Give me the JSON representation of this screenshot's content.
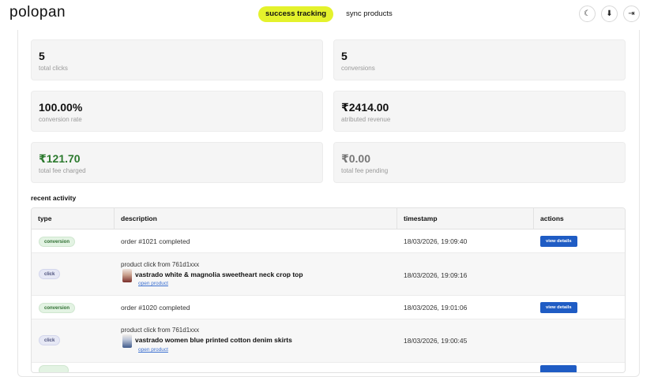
{
  "app": {
    "logo": "polopan"
  },
  "nav": {
    "tabs": [
      {
        "label": "success tracking",
        "active": true
      },
      {
        "label": "sync products",
        "active": false
      }
    ]
  },
  "top_icons": [
    {
      "name": "moon-icon",
      "glyph": "☾"
    },
    {
      "name": "download-icon",
      "glyph": "⬇"
    },
    {
      "name": "logout-icon",
      "glyph": "⇥"
    }
  ],
  "stats": [
    {
      "value": "5",
      "label": "total clicks"
    },
    {
      "value": "5",
      "label": "conversions"
    },
    {
      "value": "100.00%",
      "label": "conversion rate"
    },
    {
      "value": "₹2414.00",
      "label": "atributed revenue"
    },
    {
      "value": "₹121.70",
      "label": "total fee charged"
    },
    {
      "value": "₹0.00",
      "label": "total fee pending"
    }
  ],
  "colors": {
    "accent": "#e4f22c",
    "primary_button": "#1f5cc4",
    "fee_charged": "#2c7a2e"
  },
  "activity": {
    "title": "recent activity",
    "columns": [
      "type",
      "description",
      "timestamp",
      "actions"
    ],
    "rows": [
      {
        "type": "conversion",
        "description": "order #1021 completed",
        "timestamp": "18/03/2026, 19:09:40",
        "action": "view details"
      },
      {
        "type": "click",
        "description": "product click from 761d1xxx",
        "product_name": "vastrado white & magnolia sweetheart neck crop top",
        "link": "open product",
        "timestamp": "18/03/2026, 19:09:16"
      },
      {
        "type": "conversion",
        "description": "order #1020 completed",
        "timestamp": "18/03/2026, 19:01:06",
        "action": "view details"
      },
      {
        "type": "click",
        "description": "product click from 761d1xxx",
        "product_name": "vastrado women blue printed cotton denim skirts",
        "link": "open product",
        "timestamp": "18/03/2026, 19:00:45"
      }
    ]
  }
}
